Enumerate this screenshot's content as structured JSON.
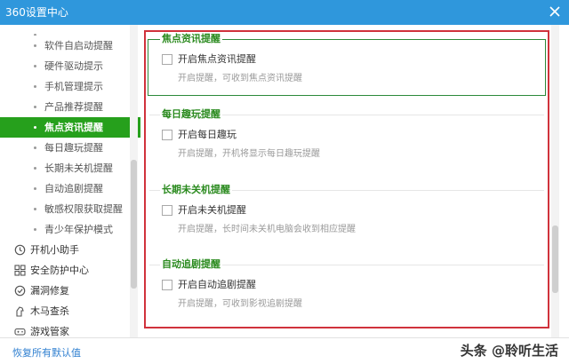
{
  "window": {
    "title": "360设置中心"
  },
  "sidebar": {
    "partial_top": "",
    "sub_items": [
      {
        "label": "软件自启动提醒",
        "active": false
      },
      {
        "label": "硬件驱动提示",
        "active": false
      },
      {
        "label": "手机管理提示",
        "active": false
      },
      {
        "label": "产品推荐提醒",
        "active": false
      },
      {
        "label": "焦点资讯提醒",
        "active": true
      },
      {
        "label": "每日趣玩提醒",
        "active": false
      },
      {
        "label": "长期未关机提醒",
        "active": false
      },
      {
        "label": "自动追剧提醒",
        "active": false
      },
      {
        "label": "敏感权限获取提醒",
        "active": false
      },
      {
        "label": "青少年保护模式",
        "active": false
      }
    ],
    "main_items": [
      {
        "label": "开机小助手",
        "icon": "clock-icon"
      },
      {
        "label": "安全防护中心",
        "icon": "shield-grid-icon"
      },
      {
        "label": "漏洞修复",
        "icon": "patch-icon"
      },
      {
        "label": "木马查杀",
        "icon": "horse-icon"
      },
      {
        "label": "游戏管家",
        "icon": "gamepad-icon"
      }
    ]
  },
  "content": {
    "sections": [
      {
        "title": "焦点资讯提醒",
        "option": "开启焦点资讯提醒",
        "desc": "开启提醒，可收到焦点资讯提醒"
      },
      {
        "title": "每日趣玩提醒",
        "option": "开启每日趣玩",
        "desc": "开启提醒，开机将显示每日趣玩提醒"
      },
      {
        "title": "长期未关机提醒",
        "option": "开启未关机提醒",
        "desc": "开启提醒，长时间未关机电脑会收到相应提醒"
      },
      {
        "title": "自动追剧提醒",
        "option": "开启自动追剧提醒",
        "desc": "开启提醒，可收到影视追剧提醒"
      }
    ]
  },
  "footer": {
    "restore_label": "恢复所有默认值",
    "watermark": "头条 @聆听生活"
  },
  "colors": {
    "titlebar": "#2f97dc",
    "active_item": "#26a01c",
    "section_title": "#2a8a1e",
    "highlight_frame": "#d0323c"
  }
}
